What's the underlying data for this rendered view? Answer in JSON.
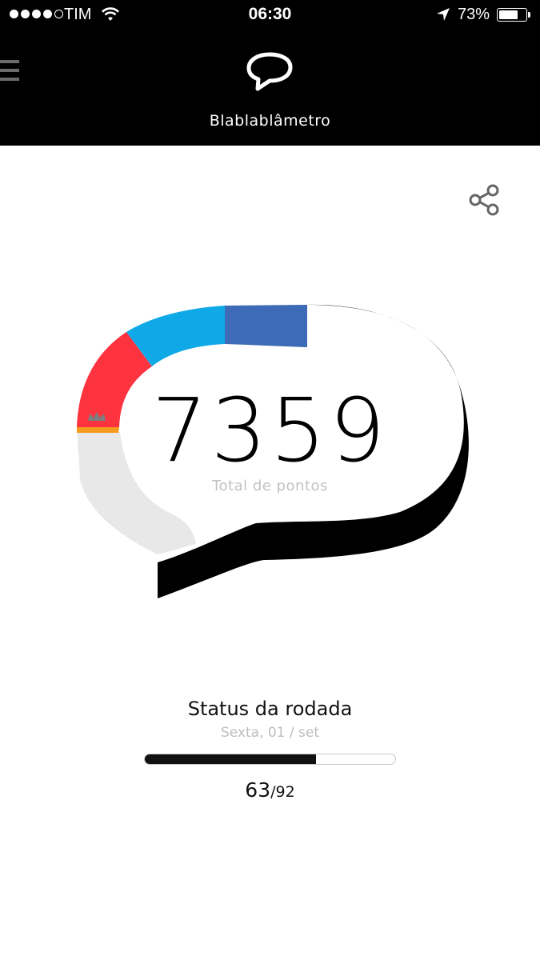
{
  "status_bar": {
    "carrier": "TIM",
    "time": "06:30",
    "battery_percent": "73%",
    "battery_level": 0.73,
    "signal_bars": 4,
    "signal_total": 5
  },
  "header": {
    "title": "Blablablâmetro",
    "icon": "speech-bubble-icon"
  },
  "actions": {
    "share_icon": "share-icon"
  },
  "gauge": {
    "score": "7359",
    "score_label": "Total de pontos",
    "segments": [
      {
        "color": "#e8e8e8",
        "status": "remaining"
      },
      {
        "color": "#f59b20",
        "status": "marker"
      },
      {
        "color": "#fe3340",
        "status": "level"
      },
      {
        "color": "#10a9e8",
        "status": "level"
      },
      {
        "color": "#3d6bb8",
        "status": "level"
      },
      {
        "color": "#000000",
        "status": "level"
      }
    ],
    "crown_icon": "crown-icon"
  },
  "round": {
    "title": "Status da rodada",
    "date": "Sexta, 01 / set",
    "current": "63",
    "total": "/92",
    "progress": 0.6848
  }
}
